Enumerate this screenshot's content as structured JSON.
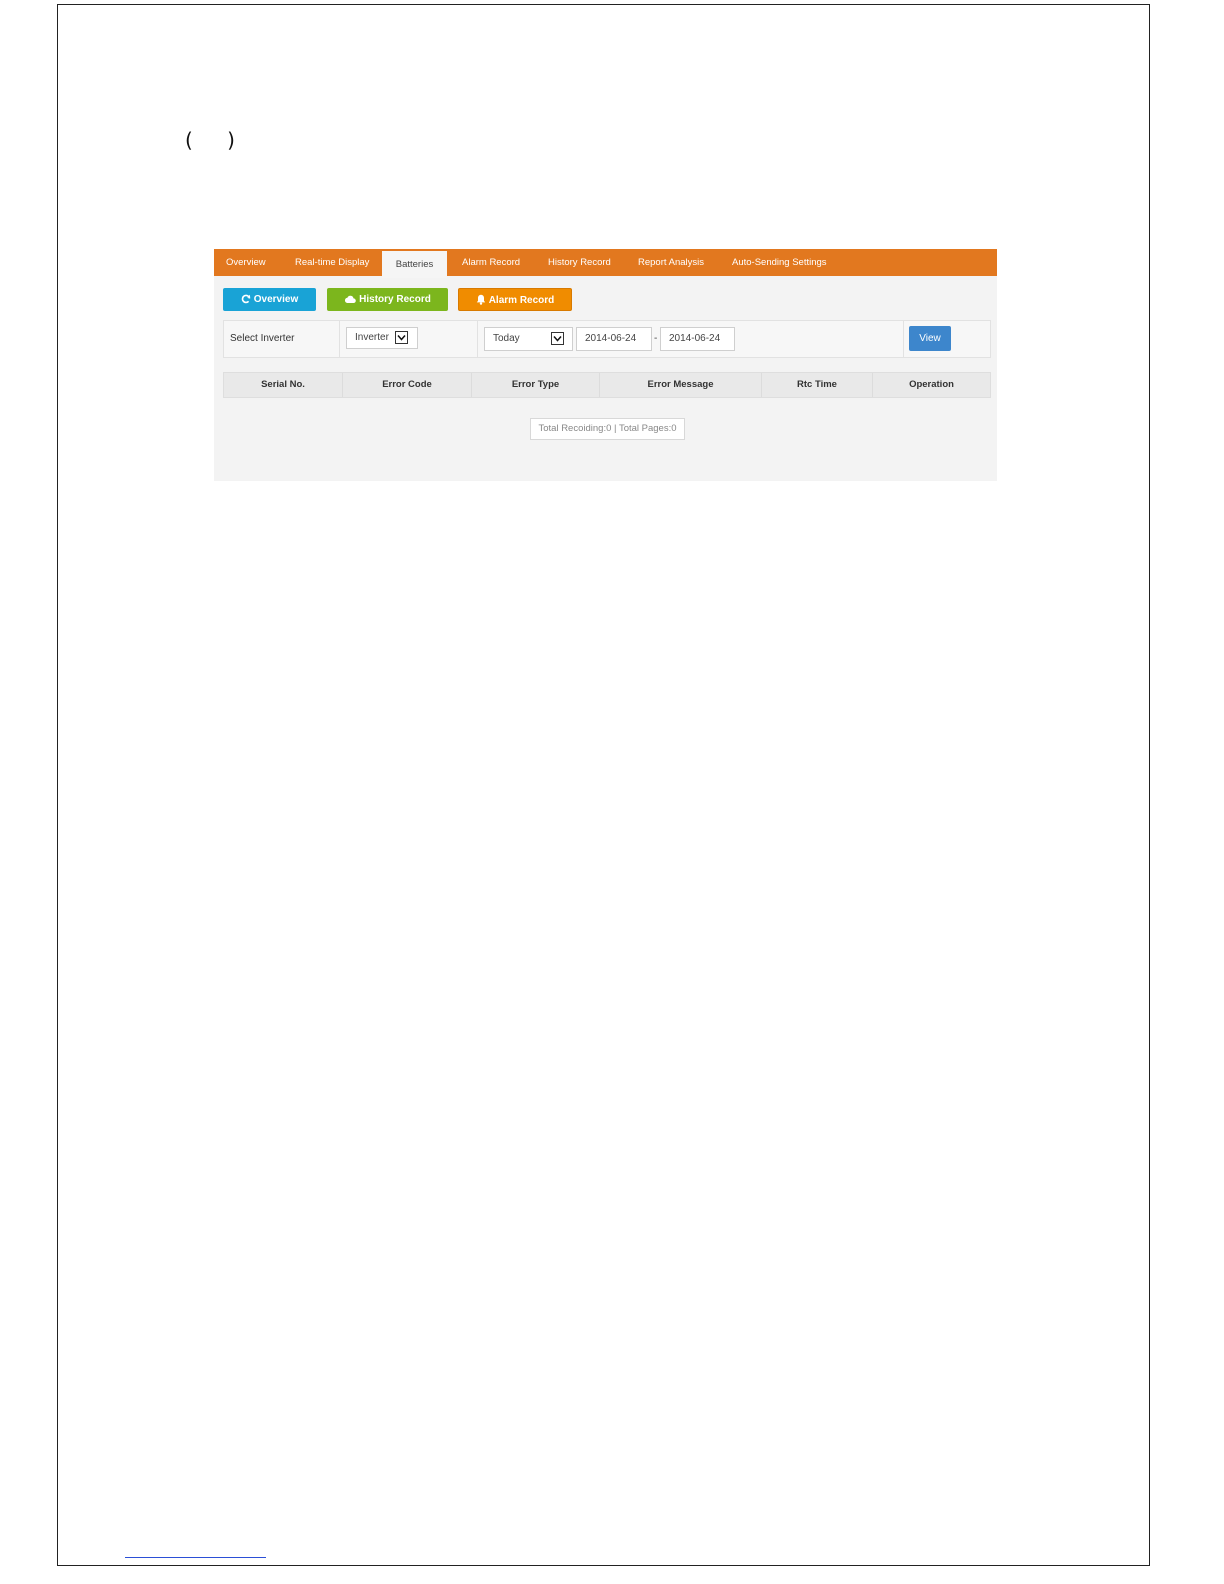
{
  "document": {
    "parentheses": "( )"
  },
  "app": {
    "tabs": [
      {
        "label": "Overview"
      },
      {
        "label": "Real-time Display"
      },
      {
        "label": "Batteries"
      },
      {
        "label": "Alarm Record"
      },
      {
        "label": "History Record"
      },
      {
        "label": "Report Analysis"
      },
      {
        "label": "Auto-Sending Settings"
      }
    ],
    "active_tab": "Batteries",
    "buttons": {
      "overview": {
        "label": "Overview",
        "icon": "refresh-icon",
        "color": "#19a3d6"
      },
      "history": {
        "label": "History Record",
        "icon": "cloud-icon",
        "color": "#7cb61d"
      },
      "alarm": {
        "label": "Alarm Record",
        "icon": "bell-icon",
        "color": "#f08c00"
      }
    },
    "filter": {
      "select_label": "Select Inverter",
      "inverter_value": "Inverter",
      "period_value": "Today",
      "start_date": "2014-06-24",
      "separator": "-",
      "end_date": "2014-06-24",
      "view_label": "View"
    },
    "table": {
      "columns": [
        "Serial No.",
        "Error Code",
        "Error Type",
        "Error Message",
        "Rtc Time",
        "Operation"
      ]
    },
    "pager": {
      "text": "Total Recoiding:0 | Total Pages:0"
    },
    "colors": {
      "tabbar": "#e2781f",
      "view_button": "#3d86cc"
    }
  }
}
